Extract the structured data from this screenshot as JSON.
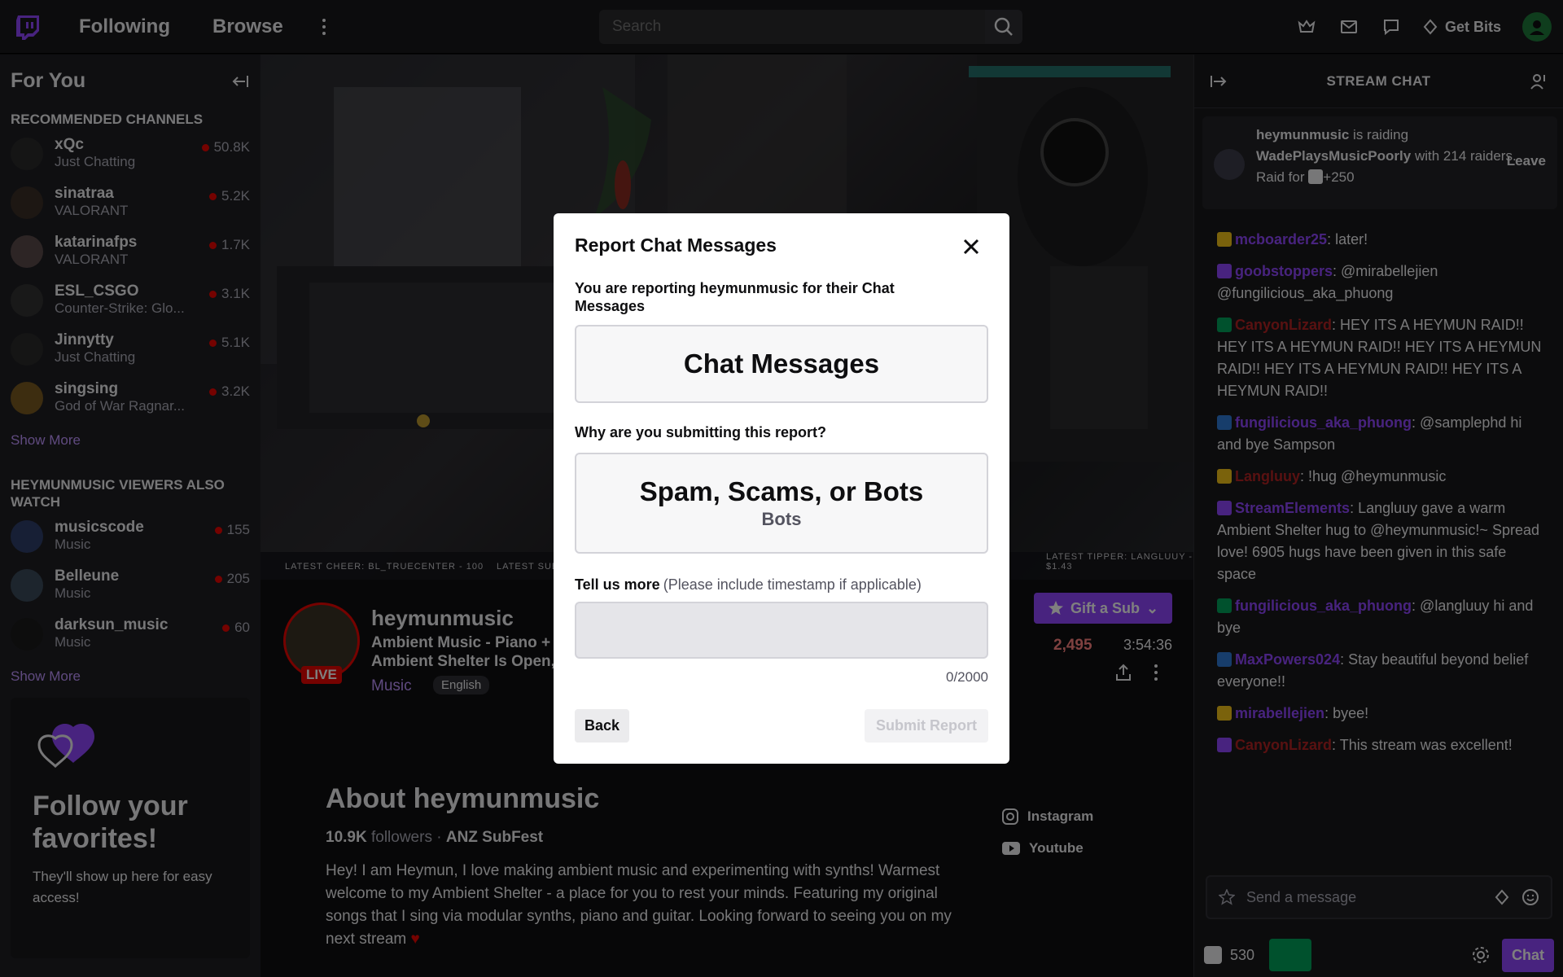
{
  "nav": {
    "following": "Following",
    "browse": "Browse",
    "search_placeholder": "Search",
    "get_bits": "Get Bits"
  },
  "sidebar": {
    "title": "For You",
    "recommended_title": "RECOMMENDED CHANNELS",
    "recommended": [
      {
        "name": "xQc",
        "game": "Just Chatting",
        "viewers": "50.8K",
        "color": "#2b2b2b"
      },
      {
        "name": "sinatraa",
        "game": "VALORANT",
        "viewers": "5.2K",
        "color": "#3a2e26"
      },
      {
        "name": "katarinafps",
        "game": "VALORANT",
        "viewers": "1.7K",
        "color": "#5a4a4a"
      },
      {
        "name": "ESL_CSGO",
        "game": "Counter-Strike: Glo...",
        "viewers": "3.1K",
        "color": "#333333"
      },
      {
        "name": "Jinnytty",
        "game": "Just Chatting",
        "viewers": "5.1K",
        "color": "#2a2a2a"
      },
      {
        "name": "singsing",
        "game": "God of War Ragnar...",
        "viewers": "3.2K",
        "color": "#7a5a20"
      }
    ],
    "show_more": "Show More",
    "also_watch_title": "HEYMUNMUSIC VIEWERS ALSO WATCH",
    "also_watch": [
      {
        "name": "musicscode",
        "game": "Music",
        "viewers": "155",
        "color": "#2f3f6a"
      },
      {
        "name": "Belleune",
        "game": "Music",
        "viewers": "205",
        "color": "#3a4a5a"
      },
      {
        "name": "darksun_music",
        "game": "Music",
        "viewers": "60",
        "color": "#1a1a1a"
      }
    ],
    "show_more_2": "Show More",
    "follow_title": "Follow your favorites!",
    "follow_text": "They'll show up here for easy access!"
  },
  "video": {
    "labels": [
      "LATEST CHEER: BL_TRUECENTER - 100",
      "LATEST SUB: JANESMITHT",
      "LATEST TIPPER: LANGLUUY - $1.43"
    ]
  },
  "channel": {
    "name": "heymunmusic",
    "live": "LIVE",
    "title": "Ambient Music - Piano + Ambient Shelter Is Open,",
    "category": "Music",
    "language": "English",
    "gift_sub": "Gift a Sub",
    "viewers": "2,495",
    "uptime": "3:54:36",
    "about_title": "About heymunmusic",
    "followers_count": "10.9K",
    "followers_label": "followers",
    "team": "ANZ SubFest",
    "about_text": "Hey! I am Heymun, I love making ambient music and experimenting with synths! Warmest welcome to my Ambient Shelter - a place for you to rest your minds. Featuring my original songs that I sing via modular synths, piano and guitar. Looking forward to seeing you on my next stream",
    "instagram": "Instagram",
    "youtube": "Youtube"
  },
  "chat": {
    "title": "STREAM CHAT",
    "raid_user": "heymunmusic",
    "raid_text_1": "is raiding",
    "raid_target": "WadePlaysMusicPoorly",
    "raid_text_2": "with 214 raiders.",
    "raid_for": "Raid for",
    "raid_bonus": "+250",
    "leave": "Leave",
    "messages": [
      {
        "user": "mcboarder25",
        "color": "#9147ff",
        "text": "later!"
      },
      {
        "user": "goobstoppers",
        "color": "#9147ff",
        "text": "@mirabellejien @fungilicious_aka_phuong"
      },
      {
        "user": "CanyonLizard",
        "color": "#b22222",
        "text": "HEY ITS A HEYMUN RAID!! HEY ITS A HEYMUN RAID!! HEY ITS A HEYMUN RAID!! HEY ITS A HEYMUN RAID!! HEY ITS A HEYMUN RAID!!"
      },
      {
        "user": "fungilicious_aka_phuong",
        "color": "#9147ff",
        "text": "@samplephd hi and bye Sampson"
      },
      {
        "user": "Langluuy",
        "color": "#b22222",
        "text": "!hug @heymunmusic"
      },
      {
        "user": "StreamElements",
        "color": "#9147ff",
        "text": "Langluuy gave a warm Ambient Shelter hug to @heymunmusic!~ Spread love! 6905 hugs have been given in this safe space"
      },
      {
        "user": "fungilicious_aka_phuong",
        "color": "#9147ff",
        "text": "@langluuy hi and bye"
      },
      {
        "user": "MaxPowers024",
        "color": "#9147ff",
        "text": "Stay beautiful beyond belief everyone!!"
      },
      {
        "user": "mirabellejien",
        "color": "#9147ff",
        "text": "byee!"
      },
      {
        "user": "CanyonLizard",
        "color": "#b22222",
        "text": "This stream was excellent!"
      }
    ],
    "input_placeholder": "Send a message",
    "points": "530",
    "chat_button": "Chat"
  },
  "modal": {
    "title": "Report Chat Messages",
    "subtitle": "You are reporting heymunmusic for their Chat Messages",
    "type": "Chat Messages",
    "question": "Why are you submitting this report?",
    "reason": "Spam, Scams, or Bots",
    "reason_sub": "Bots",
    "tell_label": "Tell us more",
    "tell_hint": "(Please include timestamp if applicable)",
    "counter": "0/2000",
    "back": "Back",
    "submit": "Submit Report"
  },
  "colors": {
    "accent": "#9147ff",
    "live": "#eb0400"
  }
}
